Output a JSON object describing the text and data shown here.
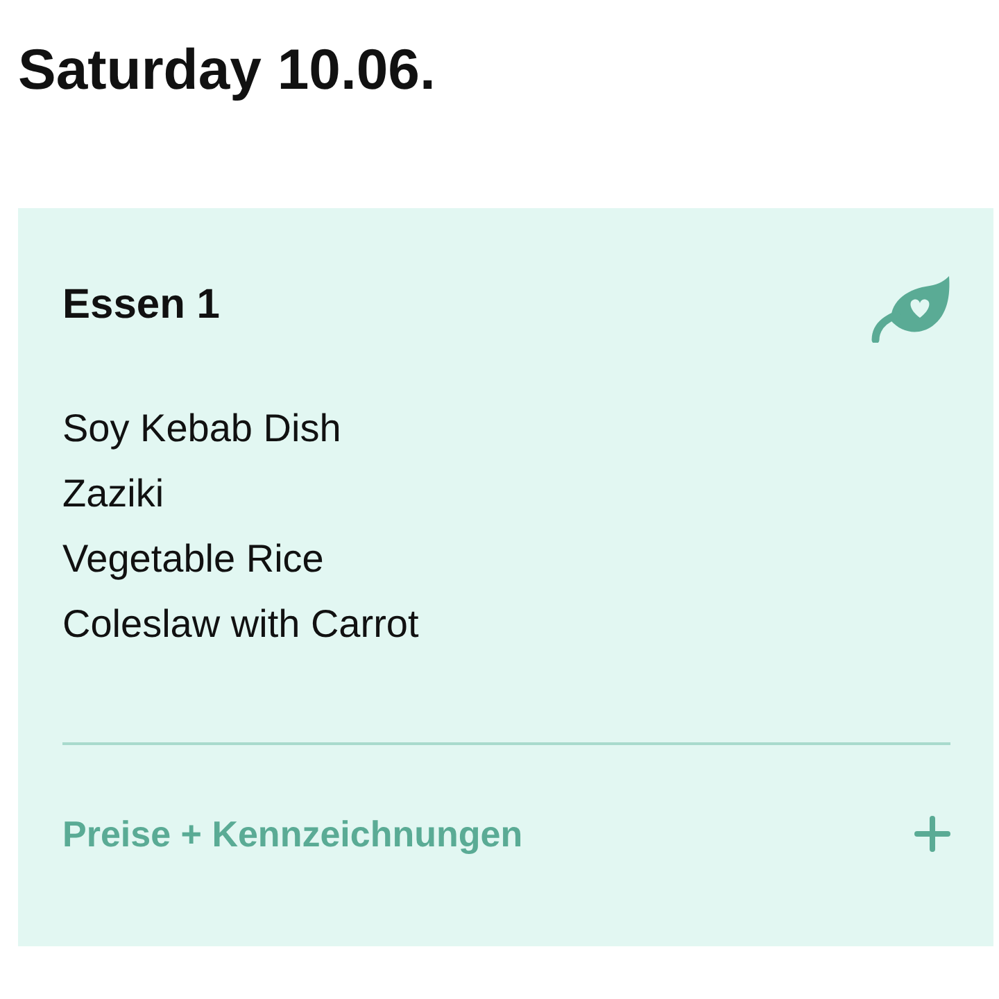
{
  "date_heading": "Saturday 10.06.",
  "meals": [
    {
      "title": "Essen 1",
      "items": [
        "Soy Kebab Dish",
        "Zaziki",
        "Vegetable Rice",
        "Coleslaw with Carrot"
      ],
      "details_toggle": {
        "label": "Preise + Kennzeichnungen",
        "expanded": false
      }
    }
  ]
}
